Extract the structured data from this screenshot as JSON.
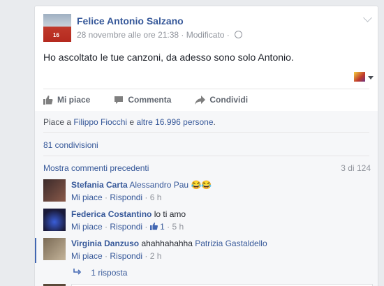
{
  "post": {
    "author": "Felice Antonio Salzano",
    "meta": "28 novembre alle ore 21:38 · Modificato ·",
    "text": "Ho ascoltato le tue canzoni, da adesso sono solo Antonio.",
    "shirt_number": "16"
  },
  "actions": {
    "like": "Mi piace",
    "comment": "Commenta",
    "share": "Condividi"
  },
  "likes": {
    "prefix": "Piace a",
    "name": "Filippo Fiocchi",
    "middle": "e",
    "others": "altre 16.996 persone",
    "suffix": "."
  },
  "shares": "81 condivisioni",
  "comments_header": {
    "more": "Mostra commenti precedenti",
    "count": "3 di 124"
  },
  "comments": [
    {
      "name": "Stefania Carta",
      "text": "Alessandro Pau",
      "emoji": "😂😂",
      "like": "Mi piace",
      "reply": "Rispondi",
      "time": "6 h"
    },
    {
      "name": "Federica Costantino",
      "text": "lo ti amo",
      "like": "Mi piace",
      "reply": "Rispondi",
      "likes_count": "1",
      "time": "5 h"
    },
    {
      "name": "Virginia Danzuso",
      "text": "ahahhahahha",
      "tag": "Patrizia Gastaldello",
      "like": "Mi piace",
      "reply": "Rispondi",
      "time": "2 h"
    }
  ],
  "replies_link": "1 risposta",
  "icons": {
    "globe": "globe-icon",
    "like": "thumbs-up-icon",
    "comment": "speech-bubble-icon",
    "share": "share-arrow-icon",
    "chevron": "chevron-down-icon",
    "reply": "reply-arrow-icon"
  },
  "colors": {
    "link": "#365899",
    "muted": "#90949c",
    "background": "#e9ebee"
  }
}
